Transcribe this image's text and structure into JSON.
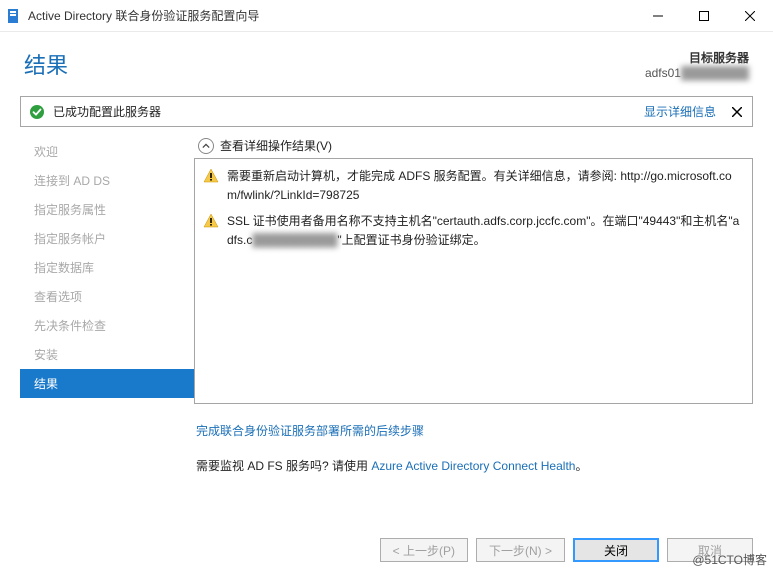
{
  "window": {
    "title": "Active Directory 联合身份验证服务配置向导"
  },
  "header": {
    "page_title": "结果",
    "target_label": "目标服务器",
    "target_value_prefix": "adfs01",
    "target_value_hidden": "████████"
  },
  "banner": {
    "message": "已成功配置此服务器",
    "details_link": "显示详细信息"
  },
  "sidebar": {
    "items": [
      {
        "label": "欢迎"
      },
      {
        "label": "连接到 AD DS"
      },
      {
        "label": "指定服务属性"
      },
      {
        "label": "指定服务帐户"
      },
      {
        "label": "指定数据库"
      },
      {
        "label": "查看选项"
      },
      {
        "label": "先决条件检查"
      },
      {
        "label": "安装"
      },
      {
        "label": "结果",
        "active": true
      }
    ]
  },
  "results": {
    "header_label": "查看详细操作结果(V)",
    "items": [
      {
        "level": "warning",
        "text_a": "需要重新启动计算机，才能完成 ADFS 服务配置。有关详细信息，请参阅: http://go.microsoft.com/fwlink/?LinkId=798725"
      },
      {
        "level": "warning",
        "text_a": "SSL 证书使用者备用名称不支持主机名\"certauth.adfs.corp.jccfc.com\"。在端口\"49443\"和主机名\"adfs.c",
        "text_hidden": "██████████",
        "text_b": "\"上配置证书身份验证绑定。"
      }
    ]
  },
  "links": {
    "followup": "完成联合身份验证服务部署所需的后续步骤",
    "monitor_prefix": "需要监视 AD FS 服务吗? 请使用 ",
    "monitor_link": "Azure Active Directory Connect Health",
    "monitor_suffix": "。"
  },
  "buttons": {
    "previous": "< 上一步(P)",
    "next": "下一步(N) >",
    "close": "关闭",
    "cancel": "取消"
  },
  "watermark": "@51CTO博客"
}
